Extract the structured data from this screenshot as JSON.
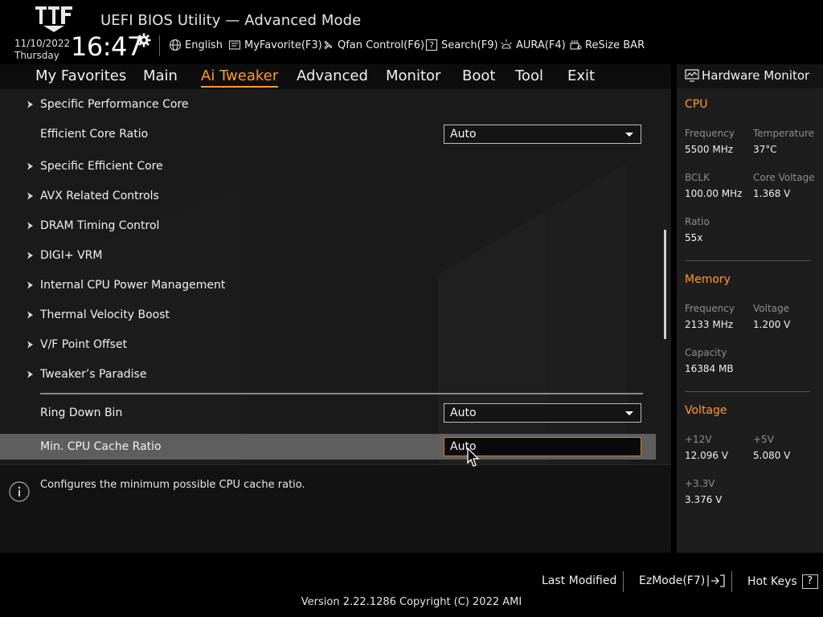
{
  "app": {
    "title": "UEFI BIOS Utility — Advanced Mode",
    "date": "11/10/2022",
    "day": "Thursday",
    "time": "16:47"
  },
  "toolbar": [
    {
      "label": "English",
      "icon": "globe-icon"
    },
    {
      "label": "MyFavorite(F3)",
      "icon": "favorite-icon"
    },
    {
      "label": "Qfan Control(F6)",
      "icon": "fan-icon"
    },
    {
      "label": "Search(F9)",
      "icon": "search-icon"
    },
    {
      "label": "AURA(F4)",
      "icon": "aura-icon"
    },
    {
      "label": "ReSize BAR",
      "icon": "resize-bar-icon"
    }
  ],
  "nav": {
    "tabs": [
      "My Favorites",
      "Main",
      "Ai Tweaker",
      "Advanced",
      "Monitor",
      "Boot",
      "Tool",
      "Exit"
    ],
    "active": "Ai Tweaker"
  },
  "settings": {
    "items": [
      {
        "label": "Specific Performance Core",
        "submenu": true
      },
      {
        "label": "Efficient Core Ratio",
        "value": "Auto"
      },
      {
        "label": "Specific Efficient Core",
        "submenu": true
      },
      {
        "label": "AVX Related Controls",
        "submenu": true
      },
      {
        "label": "DRAM Timing Control",
        "submenu": true
      },
      {
        "label": "DIGI+ VRM",
        "submenu": true
      },
      {
        "label": "Internal CPU Power Management",
        "submenu": true
      },
      {
        "label": "Thermal Velocity Boost",
        "submenu": true
      },
      {
        "label": "V/F Point Offset",
        "submenu": true
      },
      {
        "label": "Tweaker’s Paradise",
        "submenu": true
      },
      {
        "label": "Ring Down Bin",
        "value": "Auto"
      },
      {
        "label": "Min. CPU Cache Ratio",
        "value": "Auto",
        "selected": true
      }
    ]
  },
  "help": {
    "text": "Configures the minimum possible CPU cache ratio."
  },
  "hardware_monitor": {
    "title": "Hardware Monitor",
    "cpu": {
      "heading": "CPU",
      "frequency_label": "Frequency",
      "frequency": "5500 MHz",
      "temperature_label": "Temperature",
      "temperature": "37°C",
      "bclk_label": "BCLK",
      "bclk": "100.00 MHz",
      "core_voltage_label": "Core Voltage",
      "core_voltage": "1.368 V",
      "ratio_label": "Ratio",
      "ratio": "55x"
    },
    "memory": {
      "heading": "Memory",
      "frequency_label": "Frequency",
      "frequency": "2133 MHz",
      "voltage_label": "Voltage",
      "voltage": "1.200 V",
      "capacity_label": "Capacity",
      "capacity": "16384 MB"
    },
    "voltage": {
      "heading": "Voltage",
      "v12_label": "+12V",
      "v12": "12.096 V",
      "v5_label": "+5V",
      "v5": "5.080 V",
      "v33_label": "+3.3V",
      "v33": "3.376 V"
    }
  },
  "footer": {
    "last_modified": "Last Modified",
    "ezmode": "EzMode(F7)",
    "hotkeys": "Hot Keys",
    "hotkeys_symbol": "?",
    "version": "Version 2.22.1286 Copyright (C) 2022 AMI"
  },
  "colors": {
    "accent": "#ff9933",
    "selected_row": "#5e5e5e",
    "panel": "#1a1a1a"
  }
}
